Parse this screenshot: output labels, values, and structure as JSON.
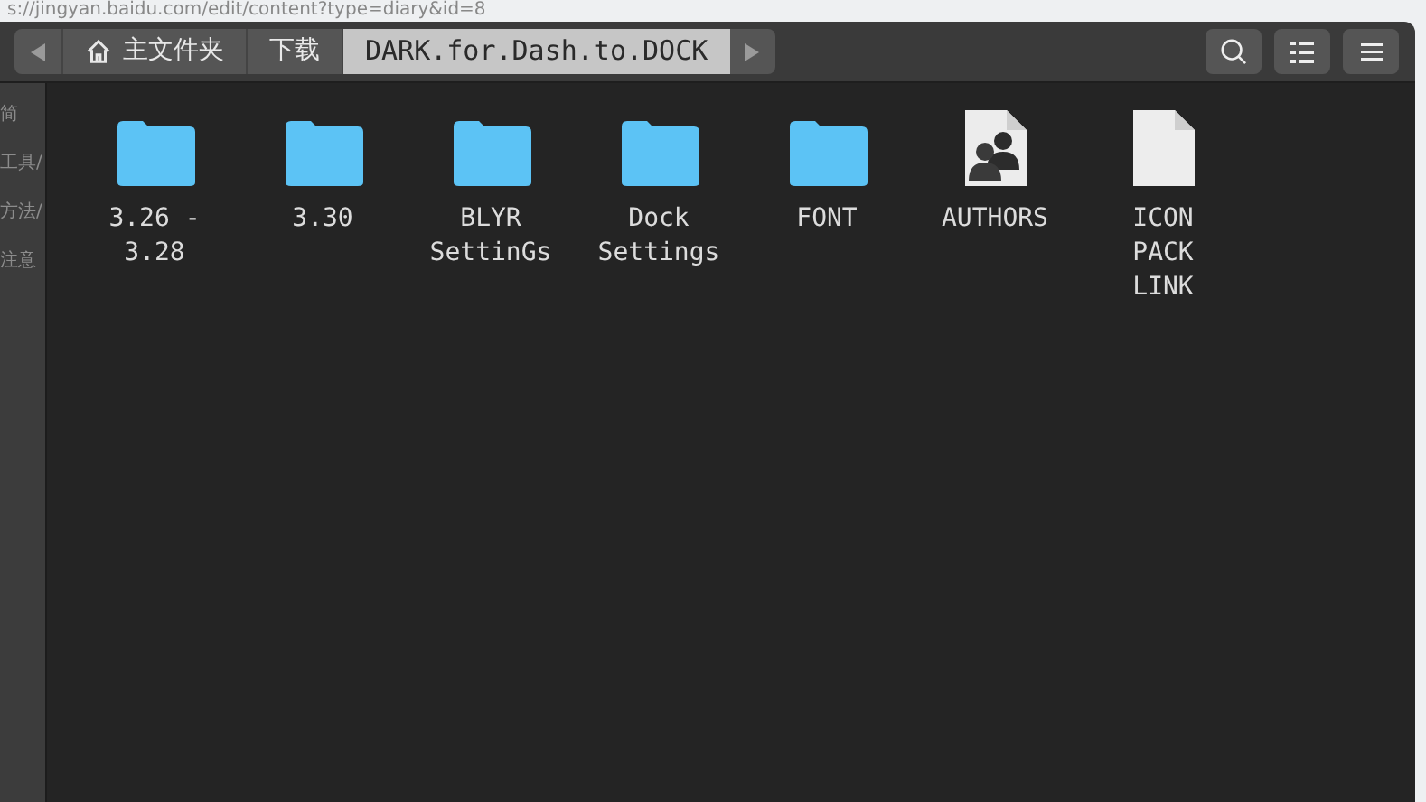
{
  "browser_background": {
    "address": "s://jingyan.baidu.com/edit/content?type=diary&id=8",
    "sidebar_items": [
      "简",
      "工具/",
      "方法/",
      "注意"
    ]
  },
  "path_bar": {
    "items": [
      {
        "kind": "home",
        "label": "主文件夹",
        "selected": false
      },
      {
        "kind": "folder",
        "label": "下载",
        "selected": false
      },
      {
        "kind": "folder",
        "label": "DARK.for.Dash.to.DOCK",
        "selected": true
      }
    ]
  },
  "files": [
    {
      "kind": "folder",
      "label": "3.26 - 3.28"
    },
    {
      "kind": "folder",
      "label": "3.30"
    },
    {
      "kind": "folder",
      "label": "BLYR SettinGs"
    },
    {
      "kind": "folder",
      "label": "Dock Settings"
    },
    {
      "kind": "folder",
      "label": "FONT"
    },
    {
      "kind": "contacts",
      "label": "AUTHORS"
    },
    {
      "kind": "document",
      "label": "ICON PACK LINK"
    }
  ]
}
